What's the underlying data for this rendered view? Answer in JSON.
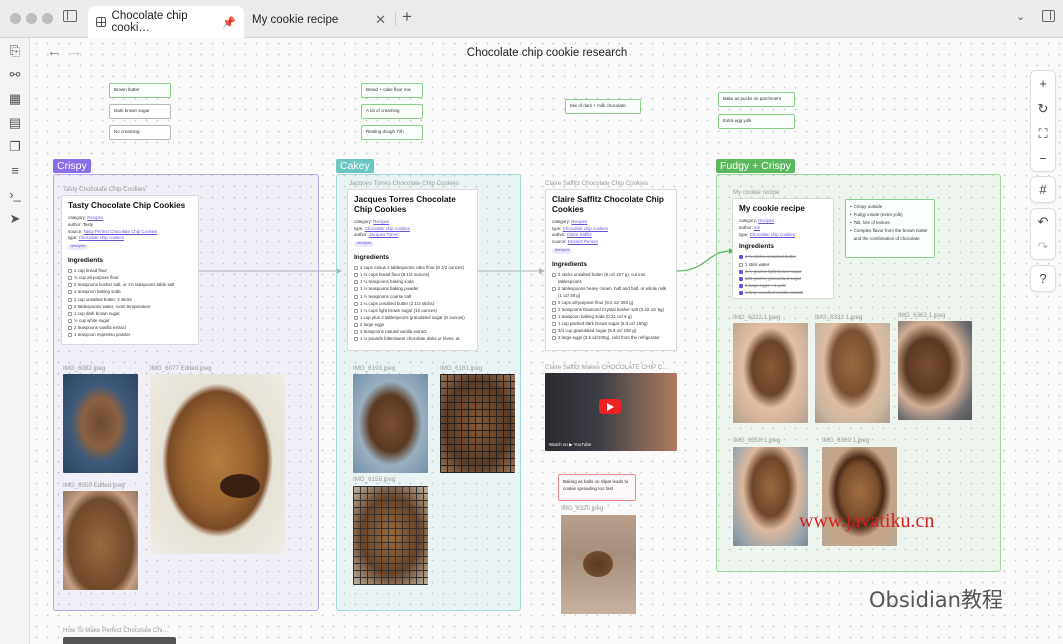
{
  "window": {
    "tabs": [
      {
        "label": "Chocolate chip cooki…",
        "pinned": true
      },
      {
        "label": "My cookie recipe"
      }
    ]
  },
  "canvas": {
    "title": "Chocolate chip cookie research",
    "notes": {
      "brown_butter": "Brown butter",
      "dark_brown_sugar": "Dark brown sugar",
      "no_creaming": "No creaming",
      "bread_cake_flour": "Bread + cake flour mix",
      "lot_of_creaming": "A lot of creaming",
      "resting_dough": "Resting dough 72h",
      "mix_chocolate": "Mix of dark + milk chocolate",
      "bake_as_pucks": "Bake as pucks on parchment",
      "extra_egg_yolk": "Extra egg yolk",
      "baking_as_balls": "Baking as balls on silpat leads to cookie spreading too fast",
      "crispy_outside": [
        "Crispy outside",
        "Fudgy inside (extra yolk)",
        "Tall, lots of texture",
        "Complex flavor from the brown butter and the combination of chocolate"
      ]
    },
    "groups": {
      "crispy": "Crispy",
      "cakey": "Cakey",
      "fudgy": "Fudgy + Crispy"
    },
    "cards": {
      "tasty": {
        "file": "Tasty Chocolate Chip Cookies",
        "title": "Tasty Chocolate Chip Cookies",
        "category_label": "category:",
        "category": "Recipes",
        "author_label": "author:",
        "author": "Tasty",
        "source_label": "source:",
        "source": "Tasty Perfect Chocolate Chip Cookies",
        "type_label": "type:",
        "type": "Chocolate chip cookies",
        "tag": "#recipes",
        "ingredients_title": "Ingredients",
        "ingredients": [
          "1 cup bread flour",
          "¾ cup all-purpose flour",
          "2 teaspoons kosher salt, or 1½ teaspoons table salt",
          "1 teaspoon baking soda",
          "1 cup unsalted butter, 2 sticks",
          "2 tablespoons water, room temperature",
          "1 cup dark brown sugar",
          "½ cup white sugar",
          "2 teaspoons vanilla extract",
          "1 teaspoon espresso powder"
        ]
      },
      "torres": {
        "file": "Jacques Torres Chocolate Chip Cookies",
        "title": "Jacques Torres Chocolate Chip Cookies",
        "category_label": "category:",
        "category": "Recipes",
        "type_label": "type:",
        "type": "Chocolate chip cookies",
        "author_label": "author:",
        "author": "Jacques Torres",
        "tag": "#recipes",
        "ingredients_title": "Ingredients",
        "ingredients": [
          "2 cups minus 2 tablespoons cake flour (8 1/2 ounces)",
          "1 ⅔ cups bread flour (8 1/2 ounces)",
          "1 ¼ teaspoons baking soda",
          "1 ½ teaspoons baking powder",
          "1 ½ teaspoons coarse salt",
          "1 ¼ cups unsalted butter (2 1/2 sticks)",
          "1 ¼ cups light brown sugar (10 ounces)",
          "1 cup plus 2 tablespoons granulated sugar (8 ounces)",
          "2 large eggs",
          "2 teaspoons natural vanilla extract",
          "1 ¼ pounds bittersweet chocolate disks or fèves, at"
        ]
      },
      "saffitz": {
        "file": "Claire Saffitz Chocolate Chip Cookies",
        "title": "Claire Saffitz Chocolate Chip Cookies",
        "category_label": "category:",
        "category": "Recipes",
        "type_label": "type:",
        "type": "Chocolate chip cookies",
        "author_label": "author:",
        "author": "Claire Saffitz",
        "source_label": "source:",
        "source": "Dessert Person",
        "tag": "#recipes",
        "ingredients_title": "Ingredients",
        "ingredients": [
          "2 sticks unsalted butter (8 oz/ 227 g), cut into tablespoons",
          "2 tablespoons heavy cream, half and half, or whole milk (1 oz/ 28 g)",
          "2 cups all-purpose flour (9.2 oz/ 260 g)",
          "2 teaspoons Diamond Crystal kosher salt (0.22 oz/ 6g)",
          "1 teaspoon baking soda (0.21 oz/ 6 g)",
          "1 cup packed dark brown sugar (6.3 oz/ 150g)",
          "3/4 cup granulated sugar (5.3 oz/ 150 g)",
          "2 large eggs (3.5 oz/100g), cold from the refrigerator"
        ]
      },
      "mine": {
        "file": "My cookie recipe",
        "title": "My cookie recipe",
        "category_label": "category:",
        "category": "Recipes",
        "author_label": "author:",
        "author": "me",
        "type_label": "type:",
        "type": "Chocolate chip cookies",
        "ingredients_title": "Ingredients",
        "ingredients": [
          "2 ½ sticks, unsalted butter",
          "1 stick water",
          "3 ½ grams, light brown sugar",
          "125 grams, granulated sugar",
          "2 large eggs + 1 yolk",
          "1 tbsp unsalted vanilla extract"
        ]
      }
    },
    "images": {
      "img6082": "IMG_6082.jpeg",
      "img6077": "IMG_6077 Edited.jpeg",
      "img6050": "IMG_6050 Edited.jpeg",
      "img6193": "IMG_6193.jpeg",
      "img6181": "IMG_6181.jpeg",
      "img6158": "IMG_6158.jpeg",
      "video_title": "Claire Saffitz Makes CHOCOLATE CHIP C…",
      "video_watch": "Watch on ▶ YouTube",
      "img6320": "IMG_6320.jpeg",
      "img6332": "IMG_6332 1.jpeg",
      "img6333": "IMG_6333 1.jpeg",
      "img6363": "IMG_6363 1.jpeg",
      "img6358": "IMG_6358 1.jpeg",
      "img6360": "IMG_6360 1.jpeg",
      "bottom_file": "How To Make Perfect Chocolate Chi…"
    },
    "watermark": "www.javatiku.cn",
    "watermark2": "Obsidian教程"
  }
}
